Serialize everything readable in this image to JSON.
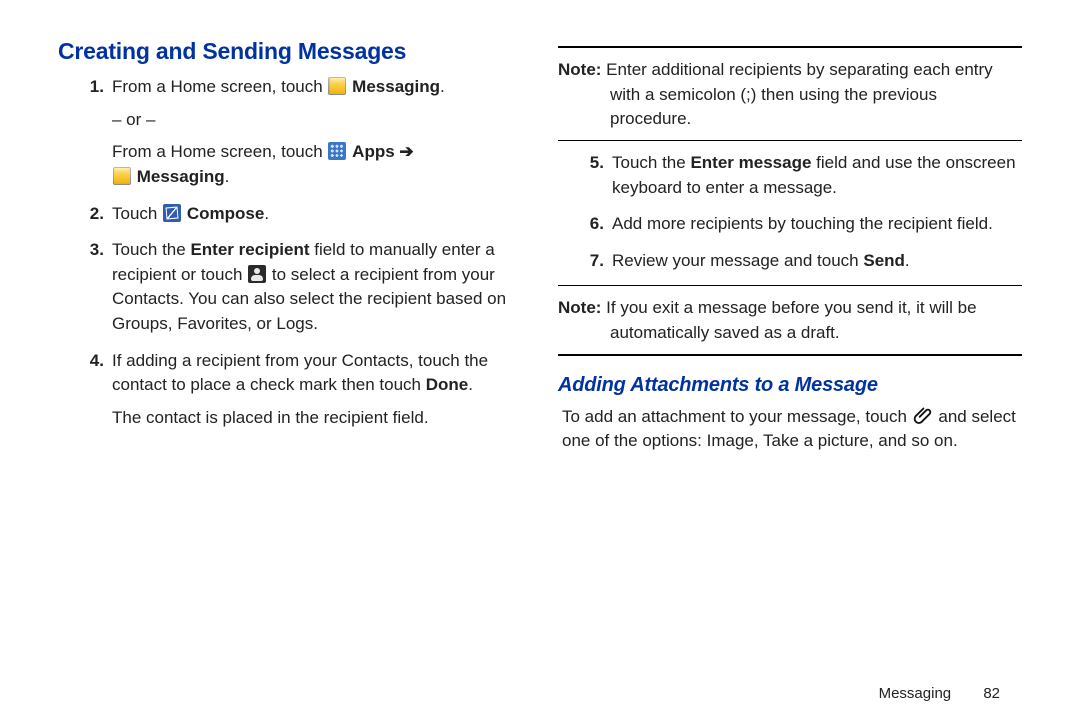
{
  "left": {
    "heading": "Creating and Sending Messages",
    "step1": {
      "pre": "From a Home screen, touch",
      "label1": "Messaging",
      "or": "– or –",
      "pre2": "From a Home screen, touch",
      "apps": "Apps",
      "arrow": "➔",
      "label2": "Messaging"
    },
    "step2": {
      "pre": "Touch",
      "label": "Compose"
    },
    "step3": {
      "a": "Touch the ",
      "bold1": "Enter recipient",
      "b": " field to manually enter a recipient or touch ",
      "c": " to select a recipient from your Contacts. You can also select the recipient based on Groups, Favorites, or Logs."
    },
    "step4": {
      "a": "If adding a recipient from your Contacts, touch the contact to place a check mark then touch ",
      "done": "Done",
      "b": ".",
      "c": "The contact is placed in the recipient field."
    }
  },
  "right": {
    "note1": {
      "label": "Note:",
      "text": " Enter additional recipients by separating each entry with a semicolon (;) then using the previous procedure."
    },
    "step5": {
      "a": "Touch the ",
      "bold": "Enter message",
      "b": " field and use the onscreen keyboard to enter a message."
    },
    "step6": "Add more recipients by touching the recipient field.",
    "step7": {
      "a": "Review your message and touch ",
      "bold": "Send",
      "b": "."
    },
    "note2": {
      "label": "Note:",
      "text": " If you exit a message before you send it, it will be automatically saved as a draft."
    },
    "subheading": "Adding Attachments to a Message",
    "attach": {
      "a": "To add an attachment to your message, touch ",
      "b": " and select one of the options: Image, Take a picture, and so on."
    }
  },
  "footer": {
    "section": "Messaging",
    "page": "82"
  }
}
